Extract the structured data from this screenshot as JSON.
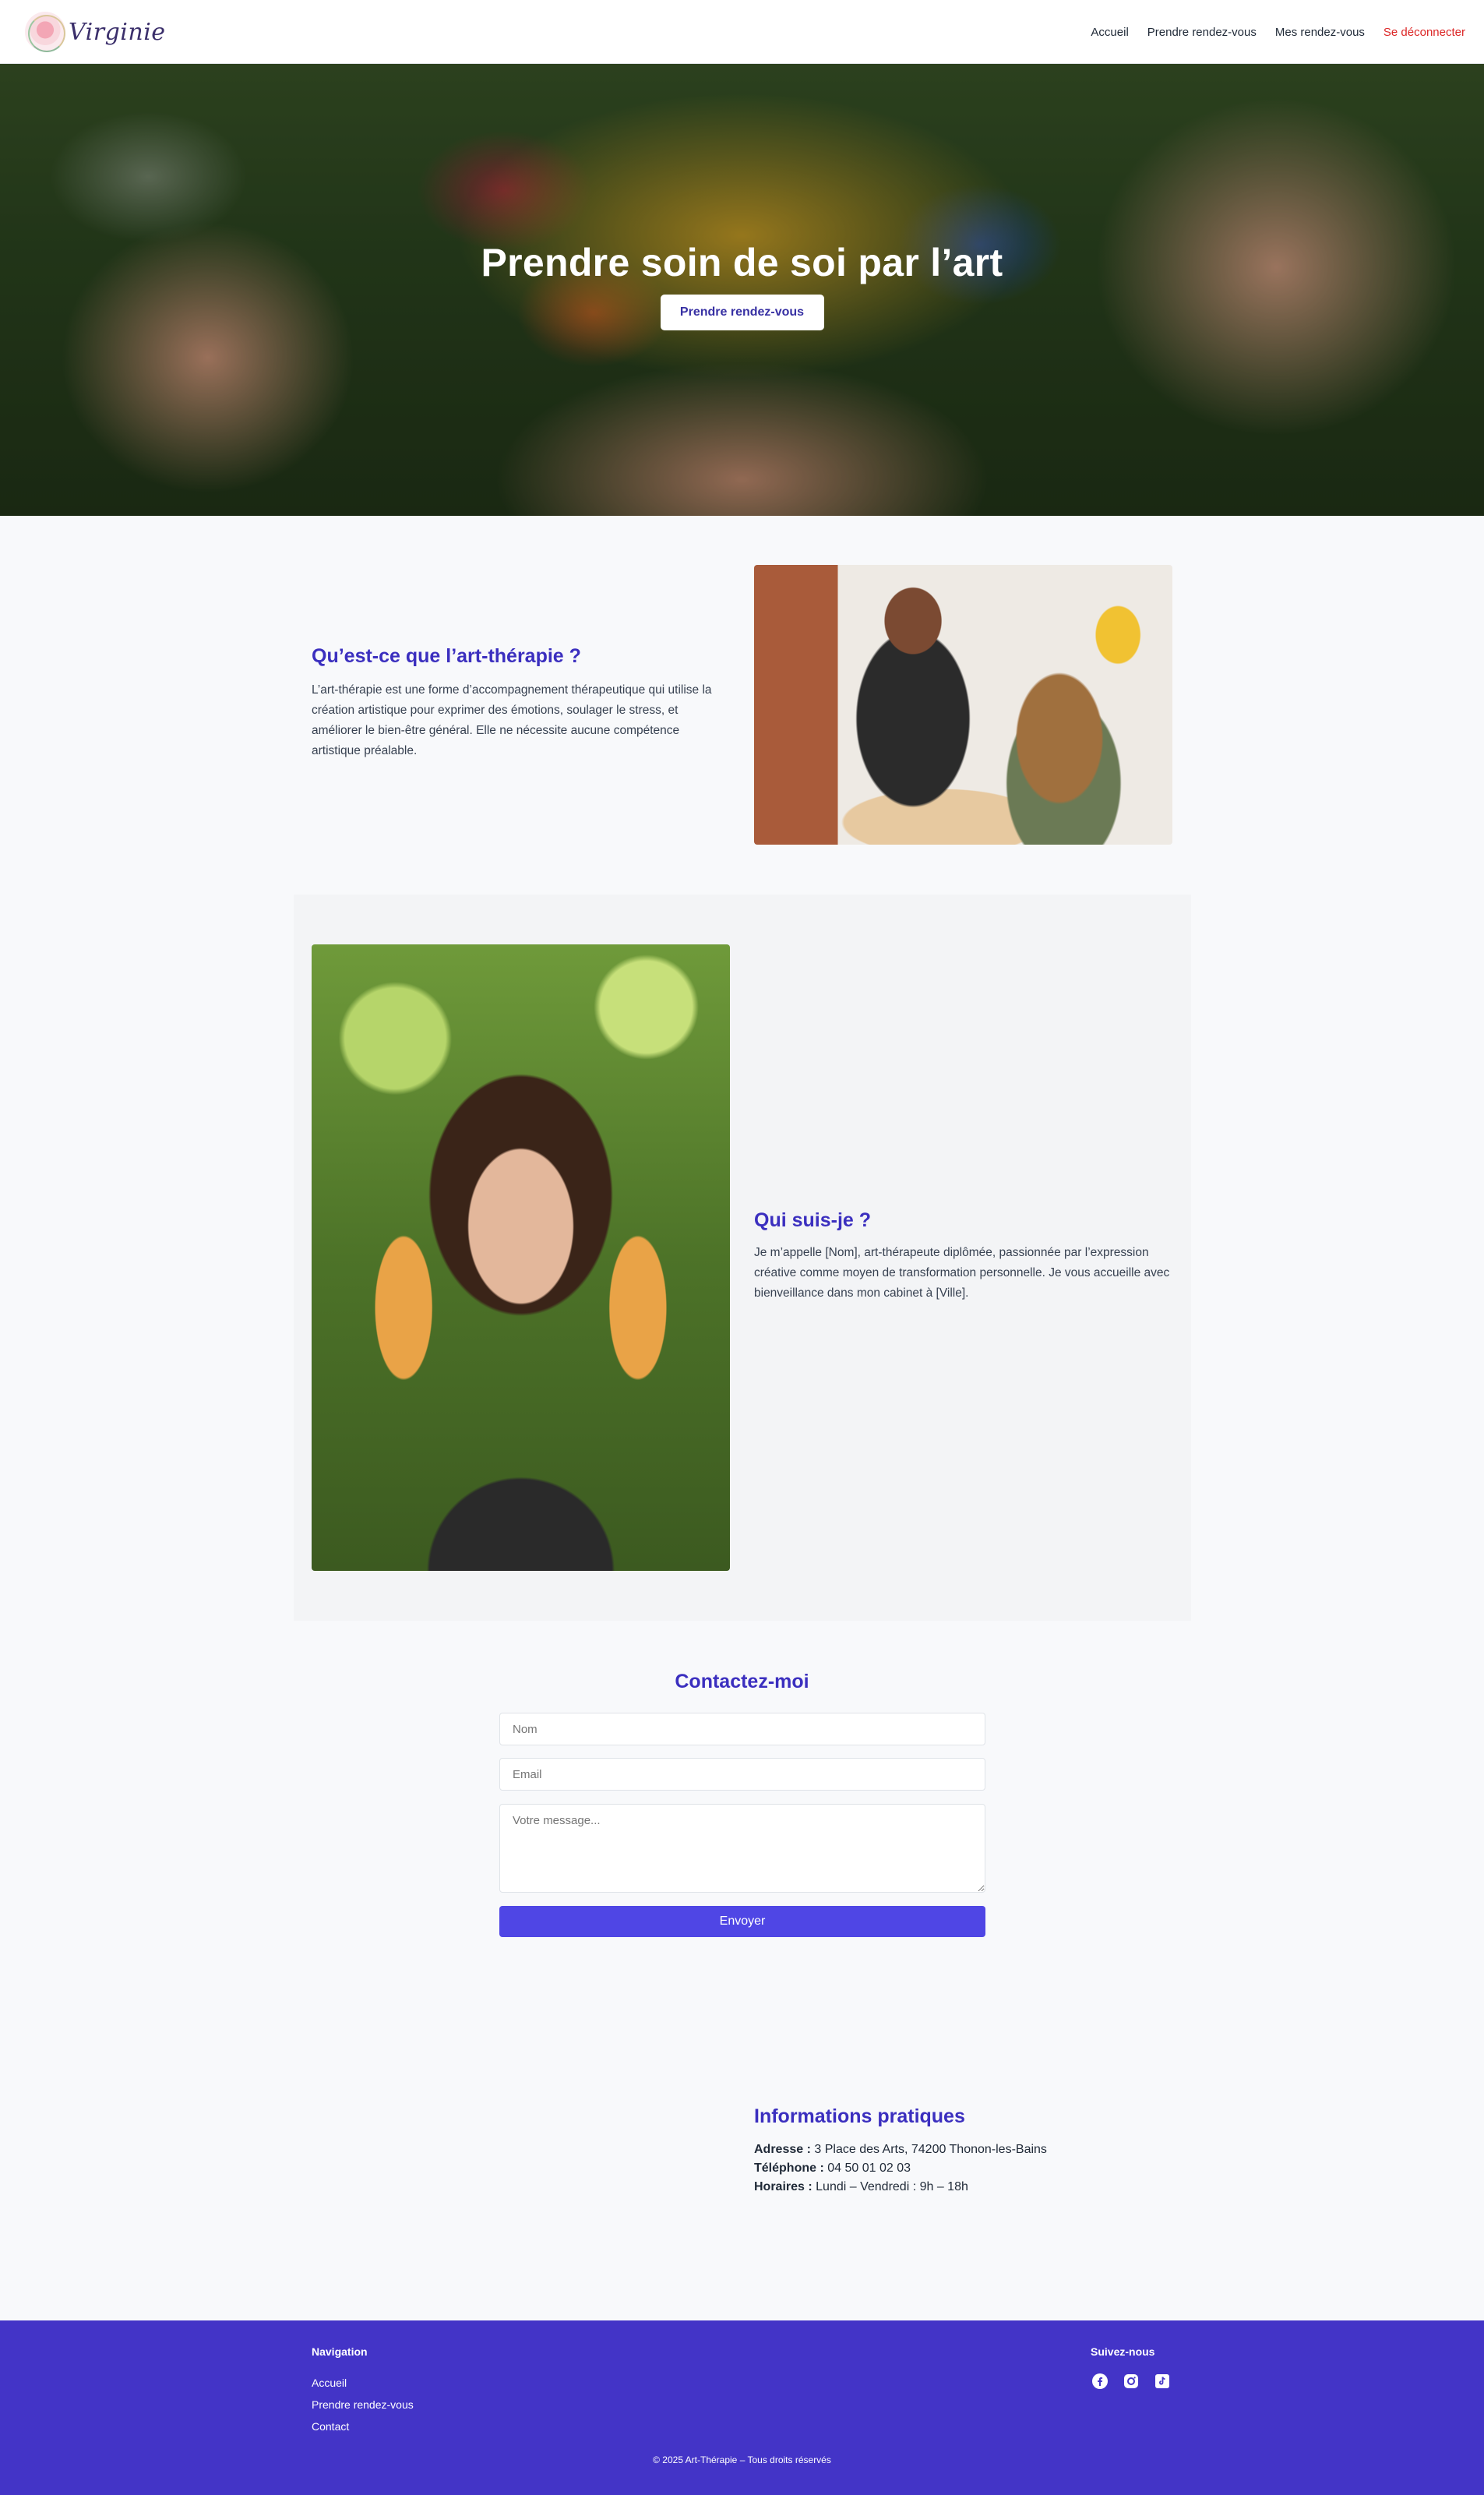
{
  "header": {
    "logo_text": "Virginie",
    "nav": {
      "home": "Accueil",
      "book": "Prendre rendez-vous",
      "my_appointments": "Mes rendez-vous",
      "logout": "Se déconnecter"
    }
  },
  "hero": {
    "title": "Prendre soin de soi par l’art",
    "cta": "Prendre rendez-vous"
  },
  "about_art_therapy": {
    "title": "Qu’est-ce que l’art-thérapie ?",
    "text": "L’art-thérapie est une forme d’accompagnement thérapeutique qui utilise la création artistique pour exprimer des émotions, soulager le stress, et améliorer le bien-être général. Elle ne nécessite aucune compétence artistique préalable."
  },
  "about_me": {
    "title": "Qui suis-je ?",
    "text": "Je m’appelle [Nom], art-thérapeute diplômée, passionnée par l’expression créative comme moyen de transformation personnelle. Je vous accueille avec bienveillance dans mon cabinet à [Ville]."
  },
  "contact": {
    "title": "Contactez-moi",
    "name_placeholder": "Nom",
    "email_placeholder": "Email",
    "message_placeholder": "Votre message...",
    "submit": "Envoyer"
  },
  "info": {
    "title": "Informations pratiques",
    "address_label": "Adresse :",
    "address": "3 Place des Arts, 74200 Thonon-les-Bains",
    "phone_label": "Téléphone :",
    "phone": "04 50 01 02 03",
    "hours_label": "Horaires :",
    "hours": "Lundi – Vendredi : 9h – 18h"
  },
  "footer": {
    "nav_title": "Navigation",
    "links": [
      "Accueil",
      "Prendre rendez-vous",
      "Contact"
    ],
    "social_title": "Suivez-nous",
    "social_icons": [
      "facebook-icon",
      "instagram-icon",
      "tiktok-icon"
    ],
    "copyright": "© 2025 Art-Thérapie – Tous droits réservés"
  },
  "colors": {
    "accent": "#3b2fbf",
    "button": "#4f46e5",
    "footer_bg": "#4334c7",
    "logout": "#dc2626"
  }
}
